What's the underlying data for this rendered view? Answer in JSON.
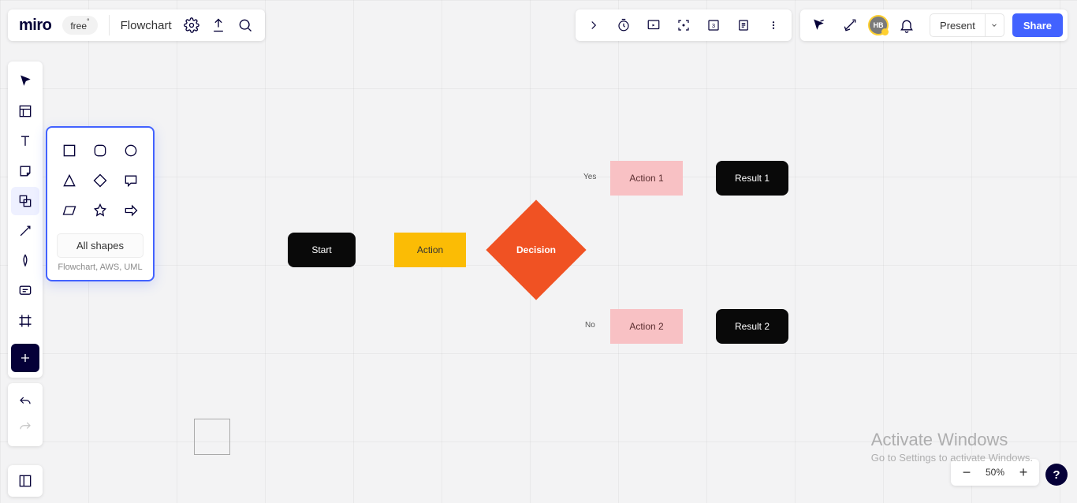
{
  "app": {
    "logo": "miro",
    "plan": "free",
    "plan_marker": "°",
    "board_name": "Flowchart"
  },
  "topbar_right": {
    "avatar_initials": "HB",
    "present_label": "Present",
    "share_label": "Share"
  },
  "shapes": {
    "all": "All shapes",
    "subtitle": "Flowchart, AWS, UML",
    "items": [
      "square",
      "rounded-rectangle",
      "circle",
      "triangle",
      "diamond",
      "speech-bubble",
      "parallelogram",
      "star",
      "arrow-right"
    ]
  },
  "flow": {
    "start": "Start",
    "action": "Action",
    "decision": "Decision",
    "yes": "Yes",
    "no": "No",
    "action1": "Action 1",
    "action2": "Action 2",
    "result1": "Result 1",
    "result2": "Result 2"
  },
  "zoom": {
    "percent": "50%"
  },
  "watermark": {
    "line1": "Activate Windows",
    "line2": "Go to Settings to activate Windows."
  }
}
